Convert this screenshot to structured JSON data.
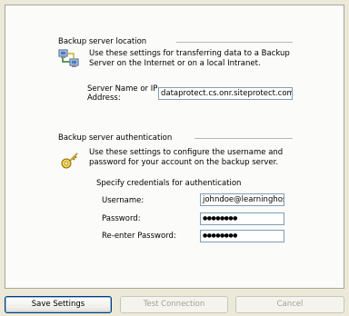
{
  "location": {
    "title": "Backup server location",
    "description": "Use these settings for transferring data to a Backup Server on the Internet or on a local Intranet.",
    "server_label": "Server Name or IP Address:",
    "server_value": "dataprotect.cs.onr.siteprotect.com"
  },
  "auth": {
    "title": "Backup server authentication",
    "description": "Use these settings to configure the username and password for your account on the backup server.",
    "specify_label": "Specify credentials for authentication",
    "username_label": "Username:",
    "username_value": "johndoe@learninghostin",
    "password_label": "Password:",
    "password_value": "●●●●●●●●",
    "reenter_label": "Re-enter Password:",
    "reenter_value": "●●●●●●●●"
  },
  "buttons": {
    "save": "Save Settings",
    "test": "Test Connection",
    "cancel": "Cancel"
  },
  "icons": {
    "network": "network-computers-icon",
    "keys": "keys-icon"
  }
}
